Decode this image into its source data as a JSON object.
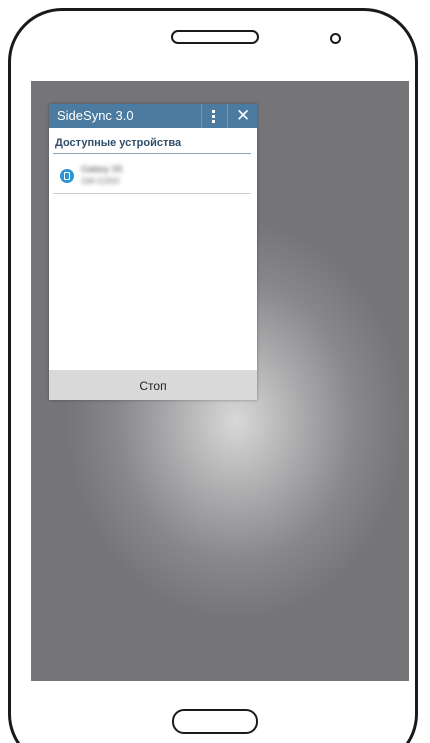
{
  "popup": {
    "title": "SideSync 3.0",
    "menu_icon": "more-vert-icon",
    "close_icon": "close-icon",
    "close_glyph": "✕",
    "section_header": "Доступные устройства",
    "devices": [
      {
        "name": "Galaxy S5",
        "subtitle": "SM-G900",
        "icon": "phone-icon",
        "icon_color": "#2b95d3"
      }
    ],
    "stop_label": "Стоп"
  },
  "colors": {
    "titlebar": "#4b7ba0",
    "header_text": "#2f4f6b",
    "stop_bar": "#d9d9d9"
  }
}
